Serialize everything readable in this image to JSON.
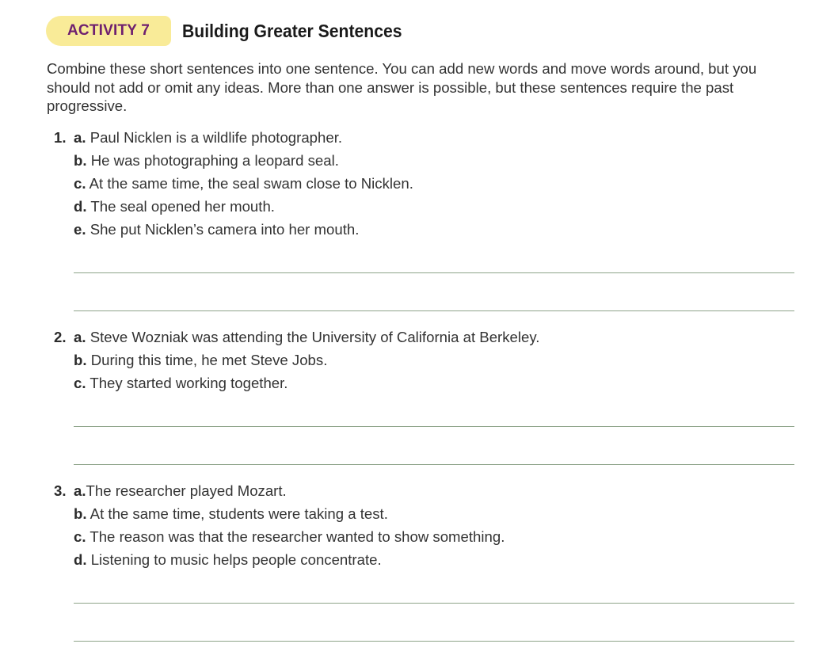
{
  "header": {
    "badge": "ACTIVITY 7",
    "title": "Building Greater Sentences"
  },
  "instructions": "Combine these short sentences into one sentence. You can add new words and move words around, but you should not add or omit any ideas. More than one answer is possible, but these sentences require the past progressive.",
  "items": [
    {
      "number": "1.",
      "lines": [
        {
          "letter": "a.",
          "text": "Paul Nicklen is a wildlife photographer."
        },
        {
          "letter": "b.",
          "text": "He was photographing a leopard seal."
        },
        {
          "letter": "c.",
          "text": "At the same time, the seal swam close to Nicklen."
        },
        {
          "letter": "d.",
          "text": "The seal opened her mouth."
        },
        {
          "letter": "e.",
          "text": "She put Nicklen’s camera into her mouth."
        }
      ]
    },
    {
      "number": "2.",
      "lines": [
        {
          "letter": "a.",
          "text": "Steve Wozniak was attending the University of California at Berkeley."
        },
        {
          "letter": "b.",
          "text": "During this time, he met Steve Jobs."
        },
        {
          "letter": "c.",
          "text": "They started working together."
        }
      ]
    },
    {
      "number": "3.",
      "lines": [
        {
          "letter": "a.",
          "text": "The researcher played Mozart."
        },
        {
          "letter": "b.",
          "text": "At the same time, students were taking a test."
        },
        {
          "letter": "c.",
          "text": "The reason was that the researcher wanted to show something."
        },
        {
          "letter": "d.",
          "text": "Listening to music helps people concentrate."
        }
      ]
    }
  ]
}
